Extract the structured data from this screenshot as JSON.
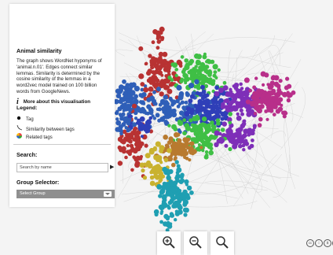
{
  "panel": {
    "title": "Animal similarity",
    "description": "The graph shows WordNet hyponyms of 'animal.n.01'. Edges connect similar lemmas. Similarity is determined by the cosine similarity of the lemmas in a word2vec model trained on 100 billion words from GoogleNews.",
    "more_label": "More about this visualisation",
    "legend_heading": "Legend:",
    "legend_items": [
      "Tag",
      "Similarity between tags",
      "Related tags"
    ],
    "search_heading": "Search:",
    "search_placeholder": "Search by name",
    "group_heading": "Group Selector:",
    "group_selected": "Select Group"
  },
  "icons": {
    "info": "info-icon",
    "zoom_in": "zoom-in-icon",
    "zoom_out": "zoom-out-icon",
    "zoom_reset": "zoom-reset-icon",
    "license": "creative-commons-icon"
  },
  "colors": {
    "clusters": [
      "#2f5fb8",
      "#b83232",
      "#3fbf45",
      "#7e2fb8",
      "#b82f8a",
      "#1f9fb2",
      "#b87a2f",
      "#c9b22f",
      "#2f3fb8"
    ]
  }
}
